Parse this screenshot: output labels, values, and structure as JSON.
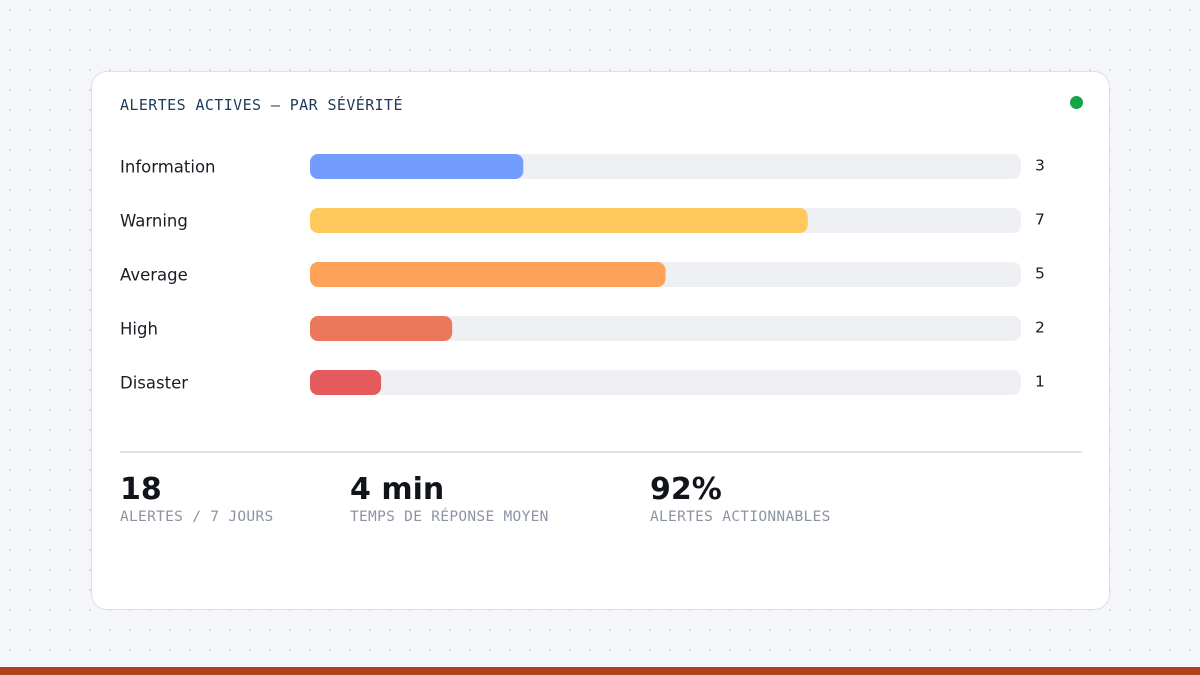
{
  "chart_data": {
    "type": "bar",
    "orientation": "horizontal",
    "title": "ALERTES ACTIVES — PAR SÉVÉRITÉ",
    "categories": [
      "Information",
      "Warning",
      "Average",
      "High",
      "Disaster"
    ],
    "values": [
      3,
      7,
      5,
      2,
      1
    ],
    "xlim": [
      0,
      10
    ],
    "colors": [
      "#739cff",
      "#ffc95c",
      "#fca359",
      "#eb785d",
      "#e55a5c"
    ],
    "track_color": "#eff0f4",
    "grid": false,
    "legend": "none"
  },
  "status": {
    "color": "#16a34a"
  },
  "stats": [
    {
      "value": "18",
      "label": "ALERTES / 7 JOURS"
    },
    {
      "value": "4 min",
      "label": "TEMPS DE RÉPONSE MOYEN"
    },
    {
      "value": "92%",
      "label": "ALERTES ACTIONNABLES"
    }
  ],
  "theme": {
    "accent_bar": "#b0401e"
  }
}
